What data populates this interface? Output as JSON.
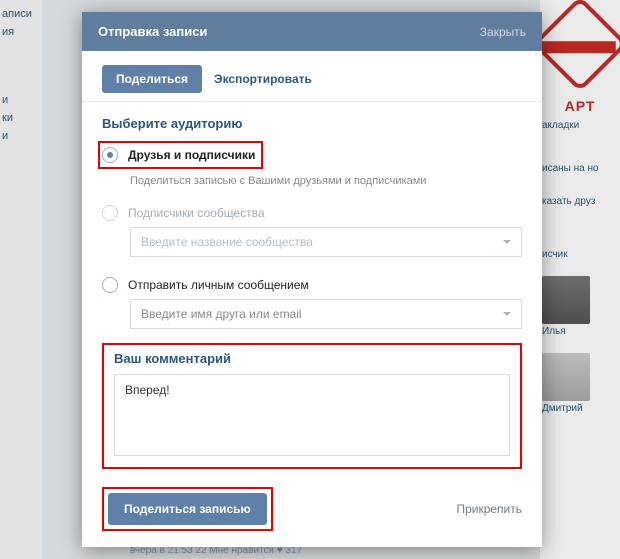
{
  "bg": {
    "left_items": [
      "аписи",
      "ия"
    ],
    "left_items2": [
      "и",
      "ки",
      "и"
    ],
    "right": {
      "brand": "АРТ",
      "links": [
        "акладки",
        "исаны на но",
        "казать друз",
        "исчик"
      ],
      "avatar1": "Илья",
      "avatar2": "Дмитрий"
    },
    "bottom": "вчера в 21:53                           22   Мне нравится ♥ 317"
  },
  "dialog": {
    "title": "Отправка записи",
    "close": "Закрыть"
  },
  "tabs": {
    "share": "Поделиться",
    "export": "Экспортировать"
  },
  "audience": {
    "title": "Выберите аудиторию",
    "opt1": {
      "label": "Друзья и подписчики",
      "sub": "Поделиться записью с Вашими друзьями и подписчиками"
    },
    "opt2": {
      "label": "Подписчики сообщества",
      "placeholder": "Введите название сообщества"
    },
    "opt3": {
      "label": "Отправить личным сообщением",
      "placeholder": "Введите имя друга или email"
    }
  },
  "comment": {
    "title": "Ваш комментарий",
    "value": "Вперед!"
  },
  "footer": {
    "submit": "Поделиться записью",
    "attach": "Прикрепить"
  }
}
